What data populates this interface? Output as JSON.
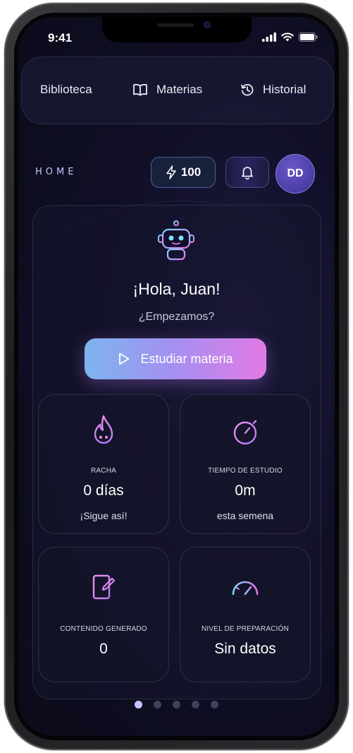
{
  "status": {
    "time": "9:41"
  },
  "nav": {
    "items": [
      {
        "label": "Biblioteca",
        "icon": "none"
      },
      {
        "label": "Materias",
        "icon": "book-icon"
      },
      {
        "label": "Historial",
        "icon": "history-icon"
      }
    ]
  },
  "header": {
    "title": "HOME",
    "energy": "100",
    "avatar_initials": "DD"
  },
  "hero": {
    "greeting": "¡Hola, Juan!",
    "subtitle": "¿Empezamos?",
    "button_label": "Estudiar materia"
  },
  "stats": [
    {
      "label": "RACHA",
      "value": "0 días",
      "note": "¡Sigue así!",
      "icon": "flame-icon"
    },
    {
      "label": "TIEMPO DE ESTUDIO",
      "value": "0m",
      "note": "esta semena",
      "icon": "stopwatch-icon"
    },
    {
      "label": "CONTENIDO GENERADO",
      "value": "0",
      "note": "",
      "icon": "edit-document-icon"
    },
    {
      "label": "NIVEL DE PREPARACIÓN",
      "value": "Sin datos",
      "note": "",
      "icon": "gauge-icon"
    }
  ],
  "pager": {
    "count": 5,
    "active": 1
  },
  "colors": {
    "accent_start": "#7db4ef",
    "accent_end": "#e27ae6",
    "background": "#0b0b1a"
  }
}
